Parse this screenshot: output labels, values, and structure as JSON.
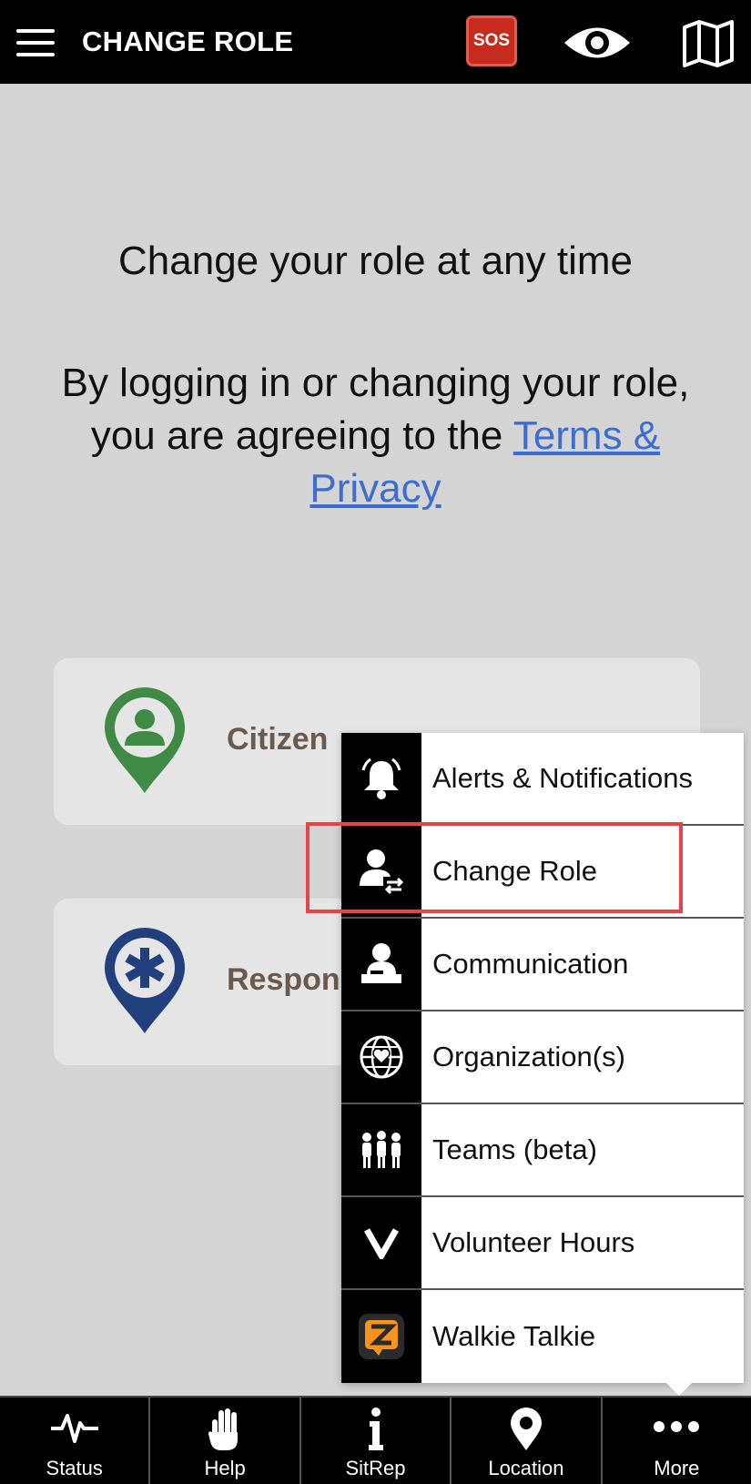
{
  "header": {
    "title": "CHANGE ROLE",
    "sos_label": "SOS"
  },
  "main": {
    "heading": "Change your role at any time",
    "terms_prefix": "By logging in or changing your role, you are agreeing to the ",
    "terms_link": "Terms & Privacy"
  },
  "roles": [
    {
      "label": "Citizen",
      "icon": "citizen-pin-icon",
      "color": "#3f8a45"
    },
    {
      "label": "Respond",
      "icon": "responder-pin-icon",
      "color": "#23407e"
    }
  ],
  "menu": {
    "items": [
      {
        "label": "Alerts & Notifications",
        "icon": "bell-icon"
      },
      {
        "label": "Change Role",
        "icon": "change-role-icon"
      },
      {
        "label": "Communication",
        "icon": "communication-icon"
      },
      {
        "label": "Organization(s)",
        "icon": "globe-heart-icon"
      },
      {
        "label": "Teams (beta)",
        "icon": "team-icon"
      },
      {
        "label": "Volunteer Hours",
        "icon": "v-icon"
      },
      {
        "label": "Walkie Talkie",
        "icon": "zello-icon"
      }
    ]
  },
  "tabs": [
    {
      "label": "Status",
      "icon": "pulse-icon"
    },
    {
      "label": "Help",
      "icon": "hand-icon"
    },
    {
      "label": "SitRep",
      "icon": "info-icon"
    },
    {
      "label": "Location",
      "icon": "location-pin-icon"
    },
    {
      "label": "More",
      "icon": "more-dots-icon"
    }
  ],
  "colors": {
    "header_bg": "#000000",
    "sos": "#c62b1e",
    "link": "#3d6ecf",
    "highlight": "#e5454a",
    "role_label": "#6b5a4c"
  }
}
